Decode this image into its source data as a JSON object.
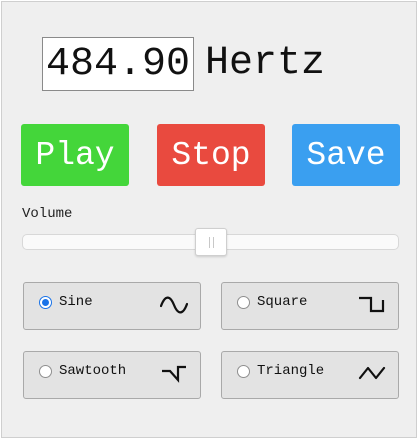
{
  "frequency": {
    "value": "484.90",
    "unit": "Hertz"
  },
  "controls": {
    "play_label": "Play",
    "stop_label": "Stop",
    "save_label": "Save",
    "colors": {
      "play": "#44d63a",
      "stop": "#e94a3f",
      "save": "#3a9ff0"
    }
  },
  "volume": {
    "label": "Volume",
    "level": 0.5
  },
  "waveforms": {
    "selected": "sine",
    "options": [
      {
        "id": "sine",
        "label": "Sine",
        "icon": "sine-wave-icon",
        "checked": true
      },
      {
        "id": "square",
        "label": "Square",
        "icon": "square-wave-icon",
        "checked": false
      },
      {
        "id": "sawtooth",
        "label": "Sawtooth",
        "icon": "sawtooth-wave-icon",
        "checked": false
      },
      {
        "id": "triangle",
        "label": "Triangle",
        "icon": "triangle-wave-icon",
        "checked": false
      }
    ]
  }
}
